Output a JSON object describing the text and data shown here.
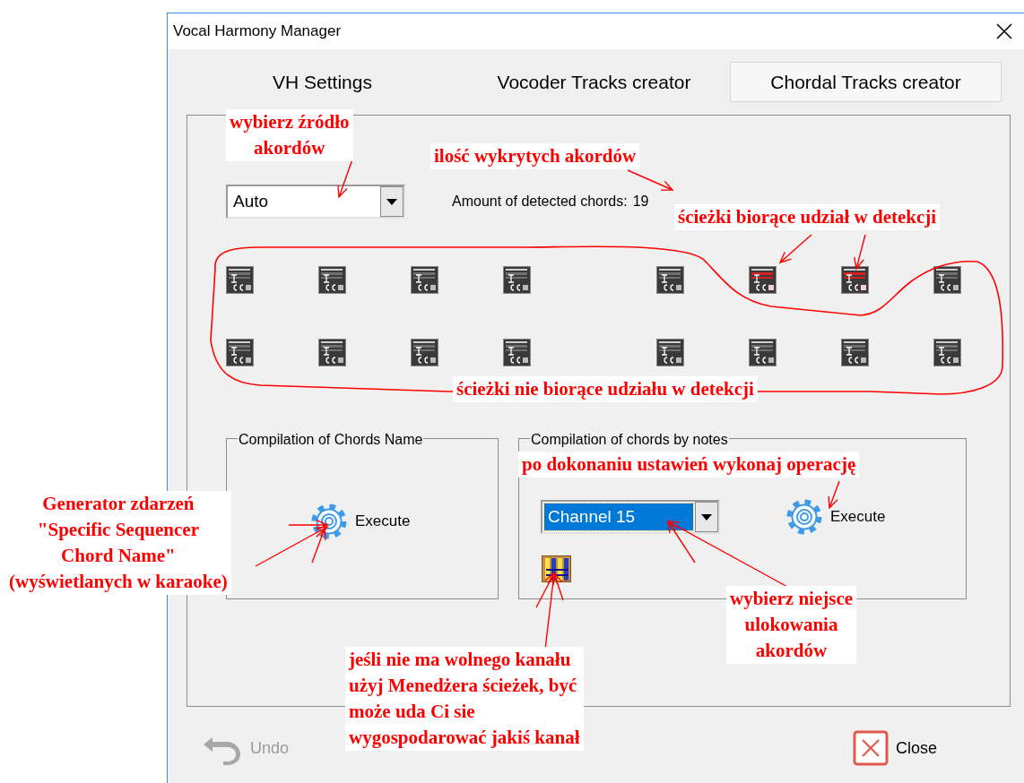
{
  "window": {
    "title": "Vocal Harmony Manager"
  },
  "tabs": [
    {
      "label": "VH Settings",
      "selected": false
    },
    {
      "label": "Vocoder Tracks creator",
      "selected": false
    },
    {
      "label": "Chordal Tracks creator",
      "selected": true
    }
  ],
  "source_select": {
    "value": "Auto",
    "focused": false
  },
  "detected": {
    "label": "Amount of detected chords:",
    "count": "19"
  },
  "track_rows": [
    {
      "tracks": [
        {
          "active": false
        },
        {
          "active": false
        },
        {
          "active": false
        },
        {
          "active": false
        },
        {
          "active": false
        },
        {
          "active": true
        },
        {
          "active": true
        },
        {
          "active": false
        }
      ]
    },
    {
      "tracks": [
        {
          "active": false
        },
        {
          "active": false
        },
        {
          "active": false
        },
        {
          "active": false
        },
        {
          "active": false
        },
        {
          "active": false
        },
        {
          "active": false
        },
        {
          "active": false
        }
      ]
    }
  ],
  "chord_name_group": {
    "title": "Compilation of Chords Name",
    "execute": "Execute"
  },
  "notes_group": {
    "title": "Compilation of chords by notes",
    "channel": {
      "value": "Channel 15",
      "focused": true
    },
    "execute": "Execute"
  },
  "buttons": [
    {
      "kind": "undo",
      "label": "Undo",
      "disabled": true
    },
    {
      "kind": "close",
      "label": "Close",
      "disabled": false
    }
  ],
  "annotations": [
    {
      "text": "wybierz źródło\nakordów"
    },
    {
      "text": "ilość wykrytych akordów"
    },
    {
      "text": "ścieżki biorące udział w detekcji"
    },
    {
      "text": "ścieżki nie biorące udziału w detekcji"
    },
    {
      "text": "po dokonaniu ustawień wykonaj operację"
    },
    {
      "text": "Generator zdarzeń\n\"Specific Sequencer\nChord Name\"\n(wyświetlanych w karaoke)"
    },
    {
      "text": "wybierz niejsce\nulokowania\nakordów"
    },
    {
      "text": "jeśli nie ma wolnego kanału\nużyj Menedżera ścieżek, być\nmoże uda Ci sie\nwygospodarować jakiś kanał"
    }
  ]
}
